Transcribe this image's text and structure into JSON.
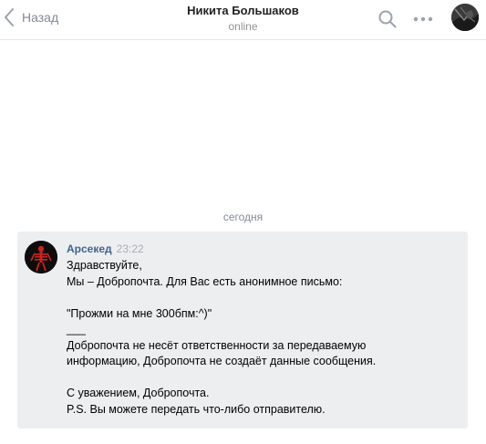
{
  "header": {
    "back_label": "Назад",
    "title": "Никита Большаков",
    "status": "online"
  },
  "date_divider": "сегодня",
  "message": {
    "author": "Арсекед",
    "time": "23:22",
    "lines": [
      "Здравствуйте,",
      "Мы – Добропочта. Для Вас есть анонимное письмо:",
      "",
      "\"Прожми на мне 300бпм:^)\"",
      "___",
      "Добропочта не несёт ответственности за передаваемую",
      "информацию, Добропочта не создаёт данные сообщения.",
      "",
      "С уважением, Добропочта.",
      "P.S. Вы можете передать что-либо отправителю."
    ]
  },
  "colors": {
    "accent": "#42648b",
    "bubble_bg": "#edeef0",
    "secondary_text": "#828a99"
  }
}
